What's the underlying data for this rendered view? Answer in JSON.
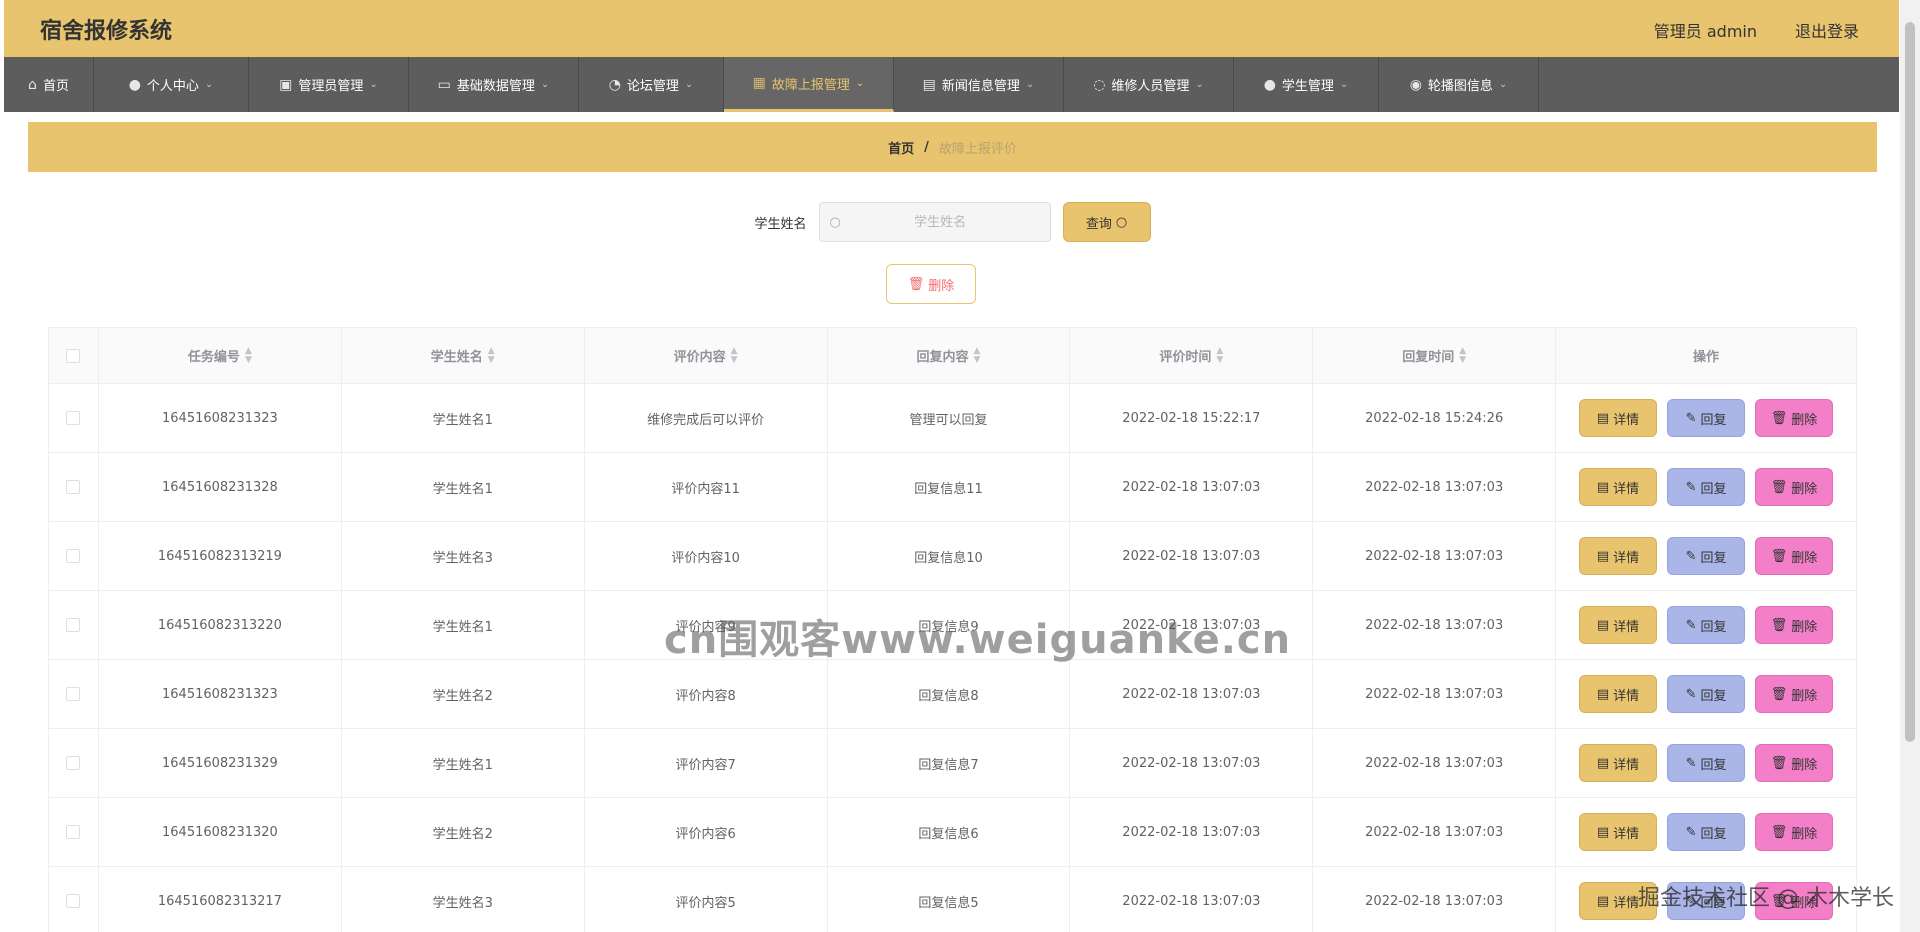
{
  "header": {
    "title": "宿舍报修系统",
    "user": "管理员 admin",
    "logout": "退出登录"
  },
  "nav": [
    {
      "icon": "home-icon",
      "glyph": "⌂",
      "label": "首页"
    },
    {
      "icon": "user-icon",
      "glyph": "●",
      "label": "个人中心"
    },
    {
      "icon": "clipboard-icon",
      "glyph": "▣",
      "label": "管理员管理"
    },
    {
      "icon": "monitor-icon",
      "glyph": "▭",
      "label": "基础数据管理"
    },
    {
      "icon": "bell-icon",
      "glyph": "◔",
      "label": "论坛管理"
    },
    {
      "icon": "grid-icon",
      "glyph": "▦",
      "label": "故障上报管理"
    },
    {
      "icon": "document-icon",
      "glyph": "▤",
      "label": "新闻信息管理"
    },
    {
      "icon": "power-icon",
      "glyph": "◌",
      "label": "维修人员管理"
    },
    {
      "icon": "user-icon",
      "glyph": "●",
      "label": "学生管理"
    },
    {
      "icon": "location-icon",
      "glyph": "◉",
      "label": "轮播图信息"
    }
  ],
  "breadcrumb": {
    "home": "首页",
    "sep": "/",
    "current": "故障上报评价"
  },
  "search": {
    "label": "学生姓名",
    "placeholder": "学生姓名",
    "query_label": "查询"
  },
  "toolbar": {
    "delete_label": "删除"
  },
  "table": {
    "columns": [
      "任务编号",
      "学生姓名",
      "评价内容",
      "回复内容",
      "评价时间",
      "回复时间"
    ],
    "ops_header": "操作",
    "ops": {
      "detail": "详情",
      "reply": "回复",
      "delete": "删除"
    },
    "rows": [
      [
        "16451608231323",
        "学生姓名1",
        "维修完成后可以评价",
        "管理可以回复",
        "2022-02-18 15:22:17",
        "2022-02-18 15:24:26"
      ],
      [
        "16451608231328",
        "学生姓名1",
        "评价内容11",
        "回复信息11",
        "2022-02-18 13:07:03",
        "2022-02-18 13:07:03"
      ],
      [
        "164516082313219",
        "学生姓名3",
        "评价内容10",
        "回复信息10",
        "2022-02-18 13:07:03",
        "2022-02-18 13:07:03"
      ],
      [
        "164516082313220",
        "学生姓名1",
        "评价内容9",
        "回复信息9",
        "2022-02-18 13:07:03",
        "2022-02-18 13:07:03"
      ],
      [
        "16451608231323",
        "学生姓名2",
        "评价内容8",
        "回复信息8",
        "2022-02-18 13:07:03",
        "2022-02-18 13:07:03"
      ],
      [
        "16451608231329",
        "学生姓名1",
        "评价内容7",
        "回复信息7",
        "2022-02-18 13:07:03",
        "2022-02-18 13:07:03"
      ],
      [
        "16451608231320",
        "学生姓名2",
        "评价内容6",
        "回复信息6",
        "2022-02-18 13:07:03",
        "2022-02-18 13:07:03"
      ],
      [
        "164516082313217",
        "学生姓名3",
        "评价内容5",
        "回复信息5",
        "2022-02-18 13:07:03",
        "2022-02-18 13:07:03"
      ]
    ]
  },
  "watermark": {
    "main": "cn围观客www.weiguanke.cn",
    "corner": "掘金技术社区 @ 木木学长"
  },
  "colors": {
    "accent": "#e8c46e",
    "nav_bg": "#5d5d5d",
    "reply_btn": "#aab6e8",
    "delete_btn": "#f27fc8"
  }
}
